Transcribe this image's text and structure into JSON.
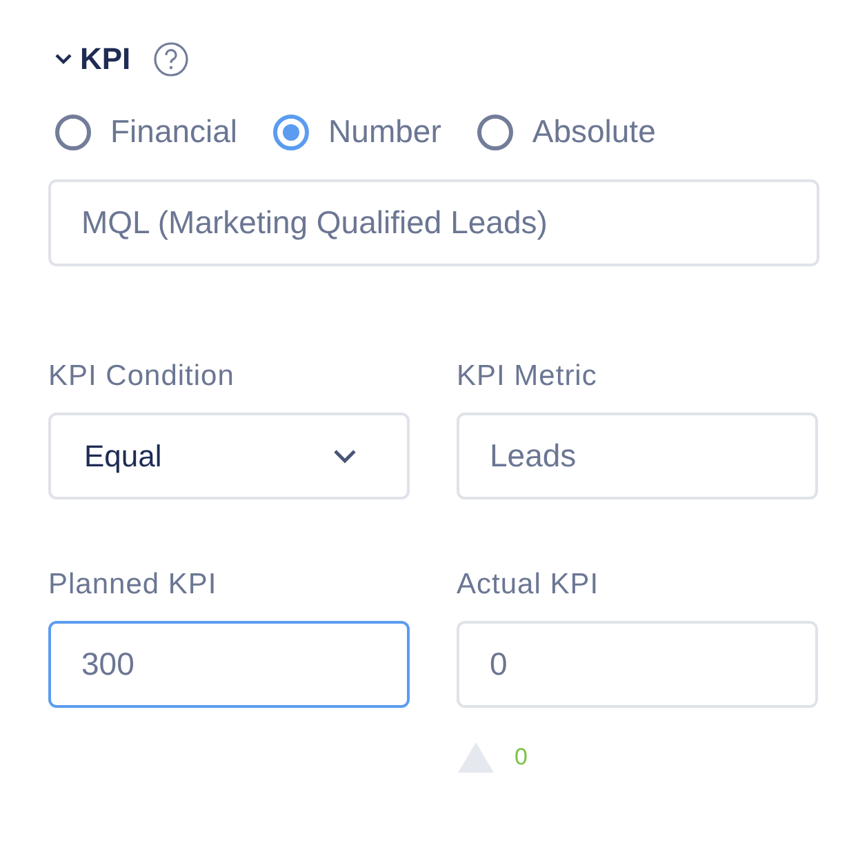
{
  "section": {
    "title": "KPI",
    "expanded": true
  },
  "kpi_type": [
    {
      "label": "Financial",
      "selected": false
    },
    {
      "label": "Number",
      "selected": true
    },
    {
      "label": "Absolute",
      "selected": false
    }
  ],
  "kpi_name": {
    "value": "MQL (Marketing Qualified Leads)"
  },
  "fields": [
    {
      "kind": "select",
      "label": "KPI Condition",
      "value": "Equal",
      "focused": false
    },
    {
      "kind": "input",
      "label": "KPI Metric",
      "value": "Leads",
      "focused": false
    },
    {
      "kind": "input",
      "label": "Planned KPI",
      "value": "300",
      "focused": true
    },
    {
      "kind": "input",
      "label": "Actual KPI",
      "value": "0",
      "focused": false
    }
  ],
  "trend": {
    "value": "0"
  }
}
